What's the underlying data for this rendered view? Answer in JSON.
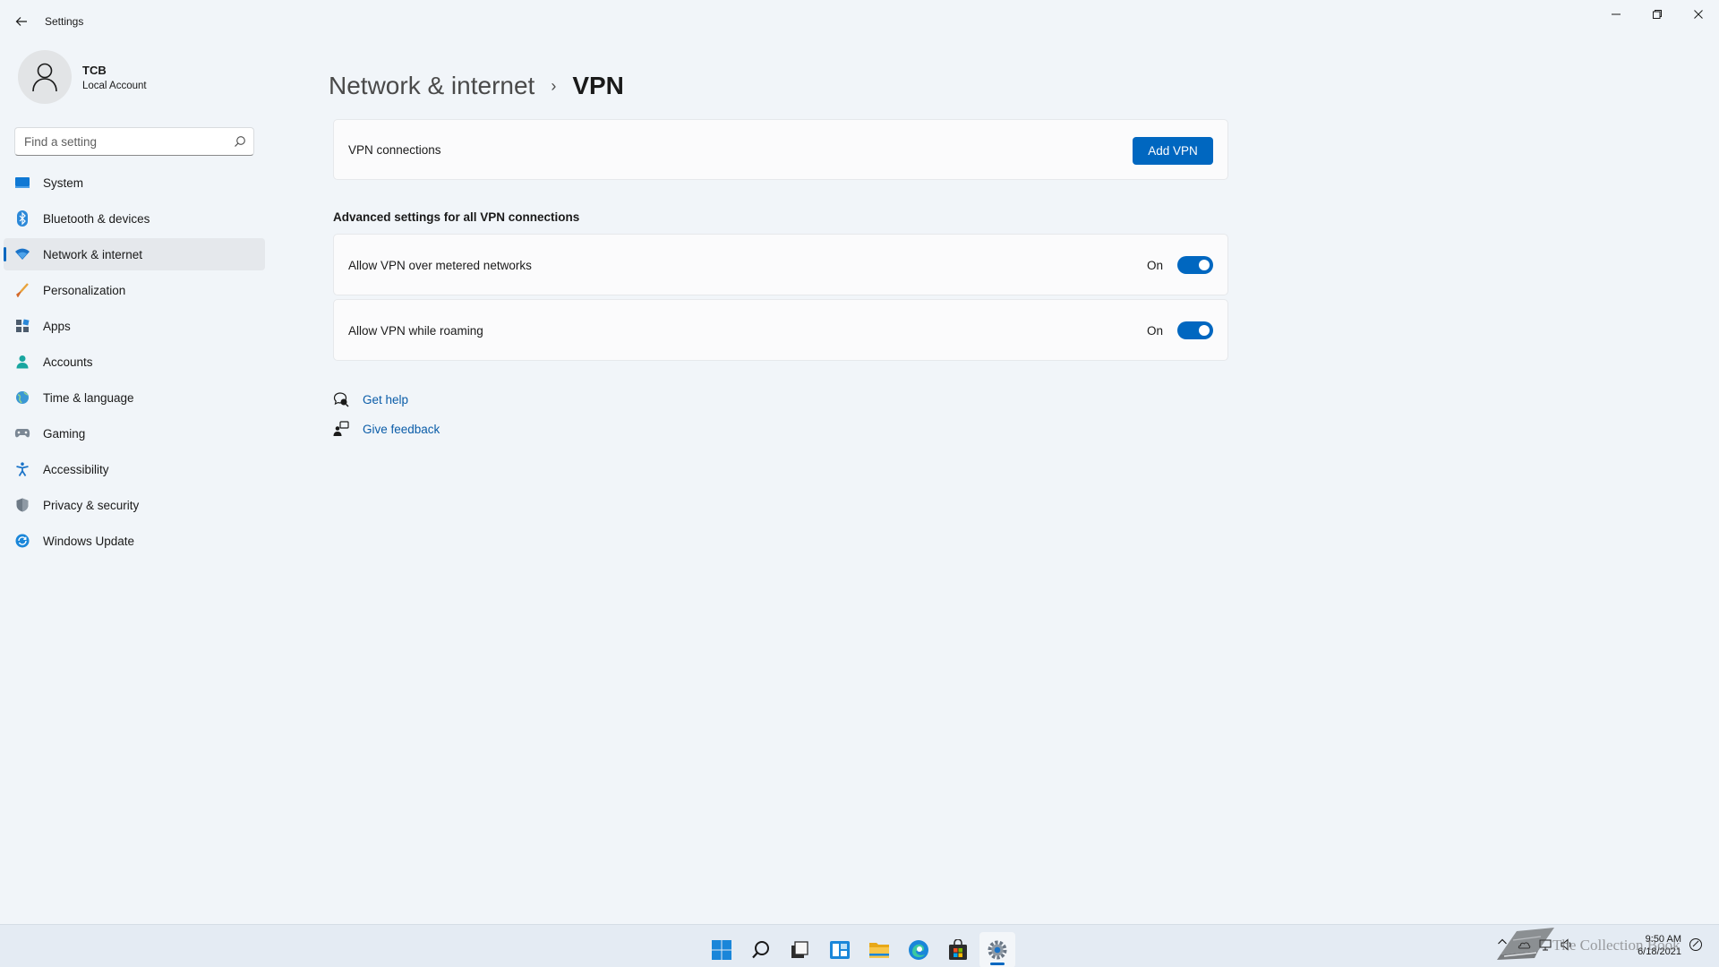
{
  "window": {
    "title": "Settings"
  },
  "profile": {
    "name": "TCB",
    "account_type": "Local Account"
  },
  "search": {
    "placeholder": "Find a setting",
    "value": ""
  },
  "sidebar": {
    "items": [
      {
        "label": "System",
        "icon": "system-icon",
        "active": false
      },
      {
        "label": "Bluetooth & devices",
        "icon": "bluetooth-icon",
        "active": false
      },
      {
        "label": "Network & internet",
        "icon": "wifi-icon",
        "active": true
      },
      {
        "label": "Personalization",
        "icon": "brush-icon",
        "active": false
      },
      {
        "label": "Apps",
        "icon": "apps-icon",
        "active": false
      },
      {
        "label": "Accounts",
        "icon": "person-icon",
        "active": false
      },
      {
        "label": "Time & language",
        "icon": "globe-icon",
        "active": false
      },
      {
        "label": "Gaming",
        "icon": "gamepad-icon",
        "active": false
      },
      {
        "label": "Accessibility",
        "icon": "accessibility-icon",
        "active": false
      },
      {
        "label": "Privacy & security",
        "icon": "shield-icon",
        "active": false
      },
      {
        "label": "Windows Update",
        "icon": "update-icon",
        "active": false
      }
    ]
  },
  "breadcrumb": {
    "parent": "Network & internet",
    "separator": "›",
    "current": "VPN"
  },
  "vpn_connections": {
    "label": "VPN connections",
    "button_label": "Add VPN"
  },
  "advanced": {
    "section_title": "Advanced settings for all VPN connections",
    "settings": [
      {
        "label": "Allow VPN over metered networks",
        "state": "On",
        "enabled": true
      },
      {
        "label": "Allow VPN while roaming",
        "state": "On",
        "enabled": true
      }
    ]
  },
  "help_links": {
    "get_help": "Get help",
    "give_feedback": "Give feedback"
  },
  "taskbar": {
    "icons": [
      "start-icon",
      "search-icon",
      "task-view-icon",
      "widgets-icon",
      "file-explorer-icon",
      "edge-icon",
      "store-icon",
      "settings-icon"
    ],
    "active": "settings-icon"
  },
  "tray": {
    "time": "9:50 AM",
    "date": "6/18/2021"
  },
  "watermark": {
    "text": "The Collection Book"
  },
  "colors": {
    "accent": "#0067c0",
    "background": "#f1f5f9",
    "card": "#fbfbfc",
    "link": "#0a5ca8"
  }
}
